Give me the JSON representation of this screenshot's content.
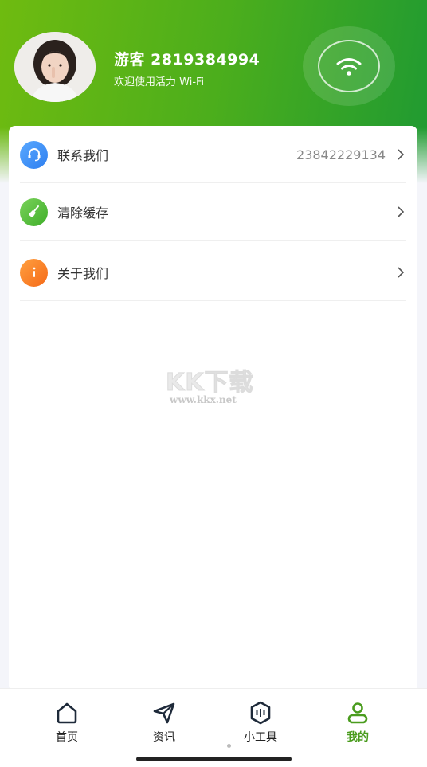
{
  "profile": {
    "name": "游客 2819384994",
    "subtitle": "欢迎使用活力 Wi-Fi",
    "avatar_icon": "user-avatar-photo",
    "wifi_icon": "wifi-icon"
  },
  "menu": {
    "items": [
      {
        "label": "联系我们",
        "value": "23842229134",
        "icon": "headset-icon",
        "color": "#3d8ef5"
      },
      {
        "label": "清除缓存",
        "value": "",
        "icon": "broom-icon",
        "color": "#55be3a"
      },
      {
        "label": "关于我们",
        "value": "",
        "icon": "info-icon",
        "color": "#f57a22"
      }
    ]
  },
  "watermark": {
    "main": "KK下载",
    "sub": "www.kkx.net"
  },
  "tabbar": {
    "tabs": [
      {
        "label": "首页",
        "icon": "home-icon"
      },
      {
        "label": "资讯",
        "icon": "send-icon"
      },
      {
        "label": "小工具",
        "icon": "toolbox-icon"
      },
      {
        "label": "我的",
        "icon": "user-icon",
        "active": true
      }
    ]
  },
  "colors": {
    "brand_green": "#4cae1c",
    "active_tab": "#4a9c1e"
  }
}
